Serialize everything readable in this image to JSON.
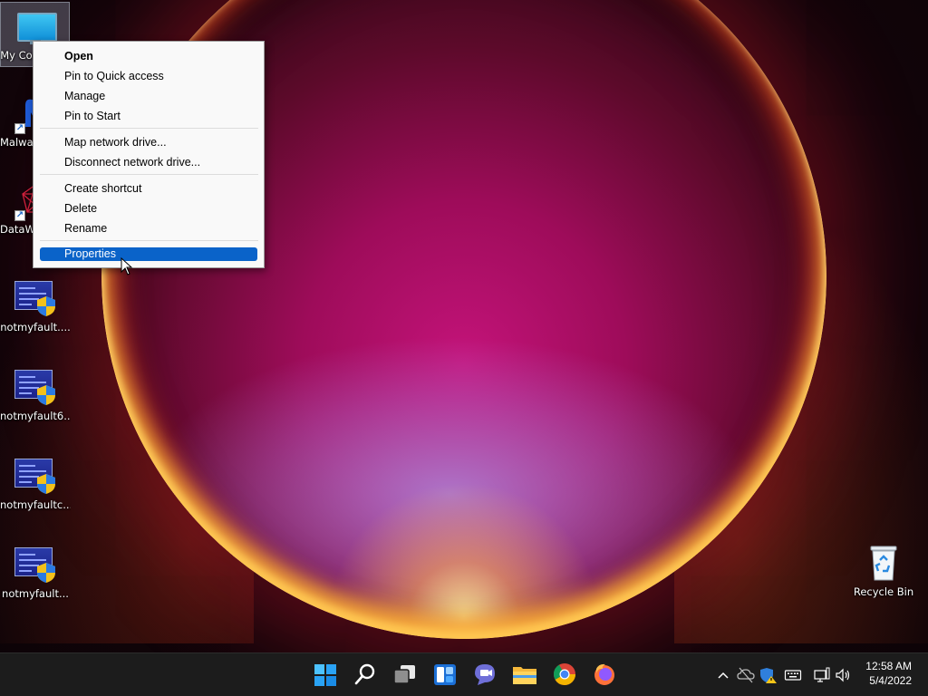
{
  "desktop": {
    "icons": [
      {
        "label": "My Computer",
        "icon": "monitor-icon"
      },
      {
        "label": "Malwarebytes",
        "icon": "malwarebytes-icon"
      },
      {
        "label": "DataWrangler",
        "icon": "datawrangler-icon"
      },
      {
        "label": "notmyfault....",
        "icon": "notmyfault-icon"
      },
      {
        "label": "notmyfault6...",
        "icon": "notmyfault-icon"
      },
      {
        "label": "notmyfaultc...",
        "icon": "notmyfault-icon"
      },
      {
        "label": "notmyfault...",
        "icon": "notmyfault-icon"
      }
    ],
    "recycle_bin": {
      "label": "Recycle Bin",
      "icon": "recycle-bin-icon"
    }
  },
  "context_menu": {
    "items": [
      {
        "label": "Open",
        "bold": true
      },
      {
        "label": "Pin to Quick access"
      },
      {
        "label": "Manage"
      },
      {
        "label": "Pin to Start"
      },
      {
        "label": "Map network drive..."
      },
      {
        "label": "Disconnect network drive..."
      },
      {
        "label": "Create shortcut"
      },
      {
        "label": "Delete"
      },
      {
        "label": "Rename"
      },
      {
        "label": "Properties",
        "highlighted": true
      }
    ]
  },
  "taskbar": {
    "apps": [
      "start-icon",
      "search-icon",
      "task-view-icon",
      "widgets-icon",
      "teams-chat-icon",
      "file-explorer-icon",
      "chrome-icon",
      "firefox-icon"
    ],
    "tray": [
      "chevron-up-icon",
      "onedrive-icon",
      "security-icon",
      "keyboard-icon",
      "network-icon",
      "volume-icon"
    ],
    "clock": {
      "time": "12:58 AM",
      "date": "5/4/2022"
    }
  },
  "colors": {
    "accent": "#0a63c9",
    "taskbar": "#1c1c1c",
    "menu_bg": "#f9f9f9"
  }
}
